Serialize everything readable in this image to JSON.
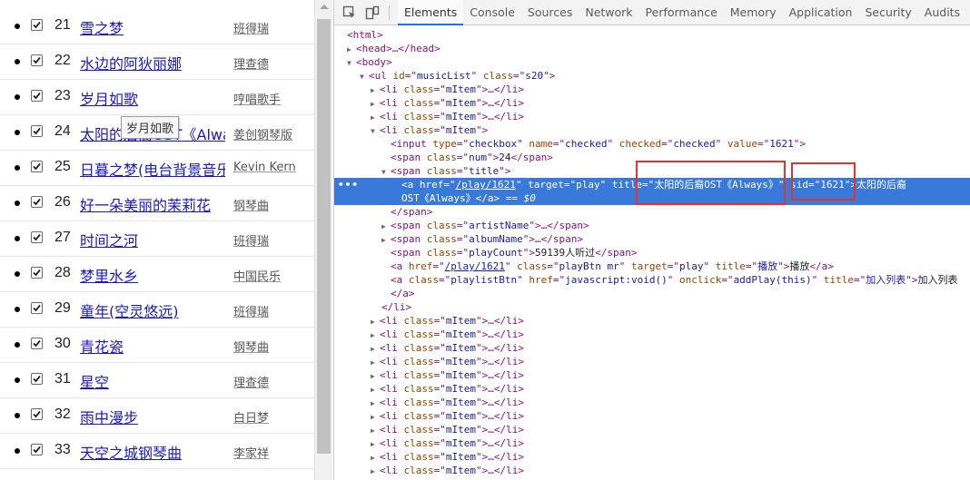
{
  "songs": [
    {
      "num": "21",
      "title": "雪之梦",
      "artist": "班得瑞",
      "checked": true
    },
    {
      "num": "22",
      "title": "水边的阿狄丽娜",
      "artist": "理查德",
      "checked": true
    },
    {
      "num": "23",
      "title": "岁月如歌",
      "artist": "哼唱歌手",
      "checked": true
    },
    {
      "num": "24",
      "title": "太阳的后裔OST《Always》",
      "artist": "姜创钢琴版",
      "checked": true
    },
    {
      "num": "25",
      "title": "日暮之梦(电台背景音乐)",
      "artist": "Kevin Kern",
      "checked": true
    },
    {
      "num": "26",
      "title": "好一朵美丽的茉莉花",
      "artist": "钢琴曲",
      "checked": true
    },
    {
      "num": "27",
      "title": "时间之河",
      "artist": "班得瑞",
      "checked": true
    },
    {
      "num": "28",
      "title": "梦里水乡",
      "artist": "中国民乐",
      "checked": true
    },
    {
      "num": "29",
      "title": "童年(空灵悠远)",
      "artist": "班得瑞",
      "checked": true
    },
    {
      "num": "30",
      "title": "青花瓷",
      "artist": "钢琴曲",
      "checked": true
    },
    {
      "num": "31",
      "title": "星空",
      "artist": "理查德",
      "checked": true
    },
    {
      "num": "32",
      "title": "雨中漫步",
      "artist": "白日梦",
      "checked": true
    },
    {
      "num": "33",
      "title": "天空之城钢琴曲",
      "artist": "李家祥",
      "checked": true
    }
  ],
  "tooltip": "岁月如歌",
  "devtools": {
    "tabs": [
      "Elements",
      "Console",
      "Sources",
      "Network",
      "Performance",
      "Memory",
      "Application",
      "Security",
      "Audits"
    ],
    "active_tab": "Elements",
    "tree": {
      "html": "<html>",
      "head": "<head>…</head>",
      "body": "<body>",
      "ul_open": "<ul id=\"musicList\" class=\"s20\">",
      "li_collapsed": "<li class=\"mItem\">…</li>",
      "li_open": "<li class=\"mItem\">",
      "input": "<input type=\"checkbox\" name=\"checked\" checked=\"checked\" value=\"1621\">",
      "num_span": "<span class=\"num\">24</span>",
      "title_span": "<span class=\"title\">",
      "anchor_line1": "<a href=\"/play/1621\" target=\"play\" title=\"太阳的后裔OST《Always》\" sid=\"1621\">太阳的后裔",
      "anchor_line2": "OST《Always》</a> == $0",
      "span_close": "</span>",
      "artist_span": "<span class=\"artistName\">…</span>",
      "album_span": "<span class=\"albumName\">…</span>",
      "playcount_span": "<span class=\"playCount\">59139人听过</span>",
      "play_btn": "<a href=\"/play/1621\" class=\"playBtn mr\" target=\"play\" title=\"播放\">播放</a>",
      "playlist_btn": "<a class=\"playlistBtn\" href=\"javascript:void()\" onclick=\"addPlay(this)\" title=\"加入列表\">加入列表",
      "a_close": "</a>",
      "li_close": "</li>"
    },
    "collapsed_li_after_count": 13
  }
}
